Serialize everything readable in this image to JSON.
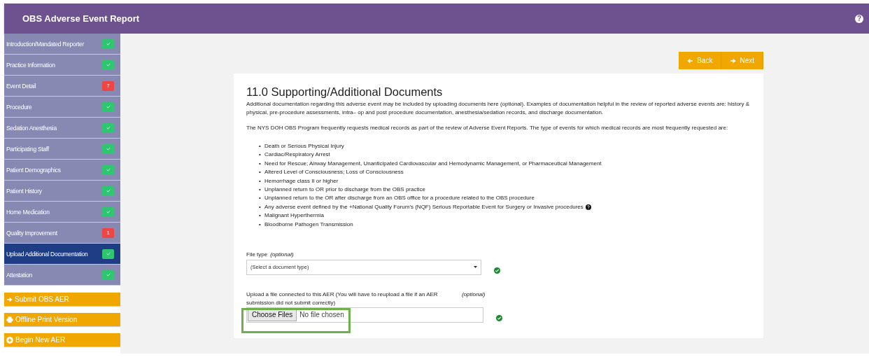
{
  "header": {
    "title": "OBS Adverse Event Report",
    "help_icon": "?"
  },
  "sidebar": {
    "items": [
      {
        "label": "Introduction/Mandated Reporter",
        "selected": false,
        "badge": {
          "kind": "check"
        }
      },
      {
        "label": "Practice Information",
        "selected": false,
        "badge": {
          "kind": "check"
        }
      },
      {
        "label": "Event Detail",
        "selected": false,
        "badge": {
          "kind": "count",
          "text": "7"
        }
      },
      {
        "label": "Procedure",
        "selected": false,
        "badge": {
          "kind": "check"
        }
      },
      {
        "label": "Sedation Anesthesia",
        "selected": false,
        "badge": {
          "kind": "check"
        }
      },
      {
        "label": "Participating Staff",
        "selected": false,
        "badge": {
          "kind": "check"
        }
      },
      {
        "label": "Patient Demographics",
        "selected": false,
        "badge": {
          "kind": "check"
        }
      },
      {
        "label": "Patient History",
        "selected": false,
        "badge": {
          "kind": "check"
        }
      },
      {
        "label": "Home Medication",
        "selected": false,
        "badge": {
          "kind": "check"
        }
      },
      {
        "label": "Quality Improvement",
        "selected": false,
        "badge": {
          "kind": "count",
          "text": "1"
        }
      },
      {
        "label": "Upload Additional Documentation",
        "selected": true,
        "badge": {
          "kind": "check"
        }
      },
      {
        "label": "Attestation",
        "selected": false,
        "badge": {
          "kind": "check"
        }
      }
    ],
    "actions": [
      {
        "label": "Submit OBS AER"
      },
      {
        "label": "Offline Print Version"
      },
      {
        "label": "Begin New AER"
      }
    ]
  },
  "nav": [
    {
      "label": "Back"
    },
    {
      "label": "Next"
    }
  ],
  "section": {
    "title": "11.0 Supporting/Additional Documents",
    "paragraphs": [
      "Additional documentation regarding this adverse event may be included by uploading documents here (optional). Examples of documentation helpful in the review of reported adverse events are: history & physical, pre-procedure assessments, intra– op and post procedure documentation, anesthesia/sedation records, and discharge documentation.",
      "The NYS DOH OBS Program frequently requests medical records as part of the review of Adverse Event Reports. The type of events for which medical records are most frequently requested are:"
    ],
    "list": [
      {
        "marker": "•",
        "text": "Death or Serious Physical Injury",
        "help": false
      },
      {
        "marker": "•",
        "text": "Cardiac/Respiratory Arrest",
        "help": false
      },
      {
        "marker": "•",
        "text": "Need for Rescue; Airway Management, Unanticipated Cardiovascular and Hemodynamic Management, or Pharmaceutical Management",
        "help": false
      },
      {
        "marker": "•",
        "text": "Altered Level of Consciousness; Loss of Consciousness",
        "help": false
      },
      {
        "marker": "•",
        "text": "Hemorrhage class II or higher",
        "help": false
      },
      {
        "marker": "•",
        "text": "Unplanned return to OR prior to discharge from the OBS practice",
        "help": false
      },
      {
        "marker": "•",
        "text": "Unplanned return to the OR after discharge from an OBS office for a procedure related to the OBS procedure",
        "help": false
      },
      {
        "marker": "•",
        "text": "Any adverse event defined by the +National Quality Forum's (NQF) Serious Reportable Event for Surgery or Invasive procedures",
        "help": true
      },
      {
        "marker": "•",
        "text": "Malignant Hyperthermia",
        "help": false
      },
      {
        "marker": "•",
        "text": "Bloodborne Pathogen Transmission",
        "help": false
      }
    ],
    "fields": [
      {
        "kind": "select",
        "label": "File type",
        "optional": "(optional)",
        "placeholder": "(Select a document type)",
        "valid": true
      },
      {
        "kind": "file",
        "label": "Upload a file connected to this AER (You will have to reupload a file if an AER submission did not submit correctly)",
        "optional": "(optional)",
        "button": "Choose Files",
        "value": "No file chosen",
        "valid": true,
        "highlighted": true
      }
    ]
  }
}
